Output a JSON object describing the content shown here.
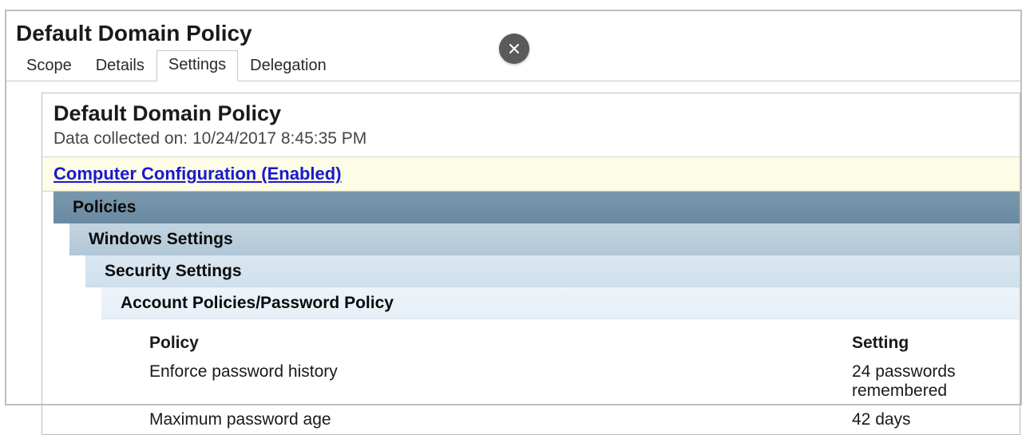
{
  "page_title": "Default Domain Policy",
  "tabs": {
    "scope": "Scope",
    "details": "Details",
    "settings": "Settings",
    "delegation": "Delegation"
  },
  "report": {
    "title": "Default Domain Policy",
    "collected_prefix": "Data collected on: ",
    "collected_at": "10/24/2017 8:45:35 PM"
  },
  "sections": {
    "computer_config": "Computer Configuration (Enabled)",
    "policies": "Policies",
    "windows": "Windows Settings",
    "security": "Security Settings",
    "account": "Account Policies/Password Policy"
  },
  "table": {
    "head_policy": "Policy",
    "head_setting": "Setting",
    "rows": [
      {
        "policy": "Enforce password history",
        "setting": "24 passwords remembered"
      },
      {
        "policy": "Maximum password age",
        "setting": "42 days"
      }
    ]
  }
}
